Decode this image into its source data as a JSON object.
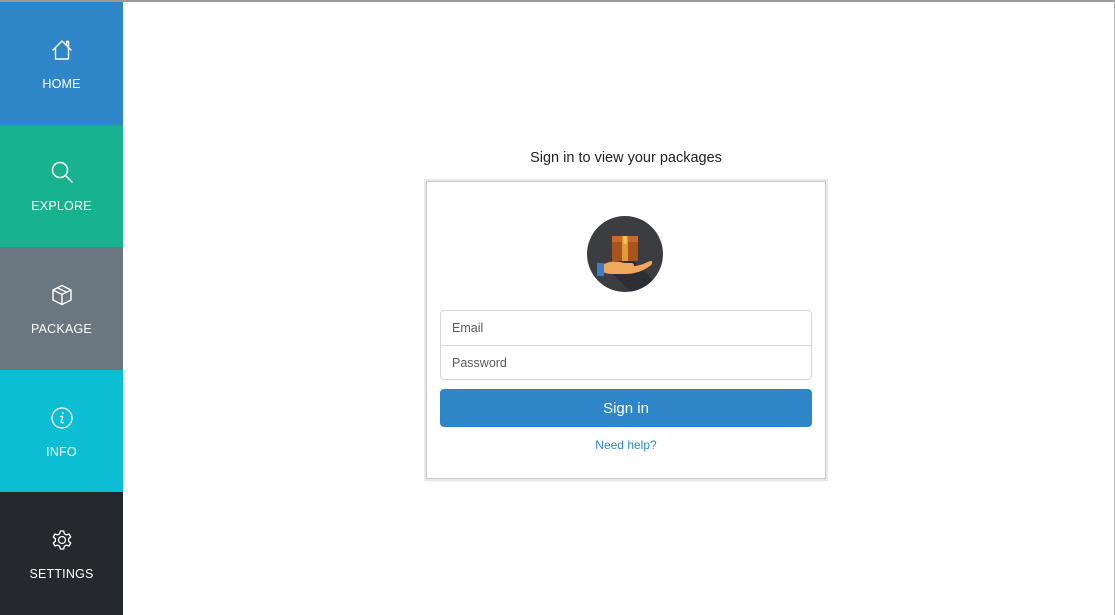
{
  "sidebar": {
    "items": [
      {
        "label": "HOME",
        "icon": "home-icon",
        "color": "#2e86c9"
      },
      {
        "label": "EXPLORE",
        "icon": "search-icon",
        "color": "#17b28e"
      },
      {
        "label": "PACKAGE",
        "icon": "package-icon",
        "color": "#6b7780"
      },
      {
        "label": "INFO",
        "icon": "info-icon",
        "color": "#0dbdd4"
      },
      {
        "label": "SETTINGS",
        "icon": "gear-icon",
        "color": "#25282c"
      }
    ]
  },
  "signin": {
    "title": "Sign in to view your packages",
    "logo_icon": "package-hand-icon",
    "email_placeholder": "Email",
    "password_placeholder": "Password",
    "button_label": "Sign in",
    "help_link": "Need help?",
    "accent_color": "#2e86c9"
  }
}
